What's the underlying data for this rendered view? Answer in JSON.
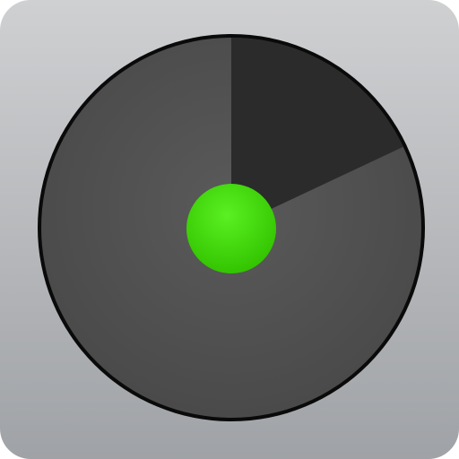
{
  "app_icon": {
    "icon": "timer-dial-icon",
    "elapsed_fraction": 0.18,
    "colors": {
      "tile_top": "#cfd0d2",
      "tile_bottom": "#9fa2a6",
      "dial_face": "#505050",
      "dial_rim": "#0a0a0a",
      "elapsed_wedge": "#2b2b2b",
      "center_knob": "#3ed40a"
    }
  }
}
